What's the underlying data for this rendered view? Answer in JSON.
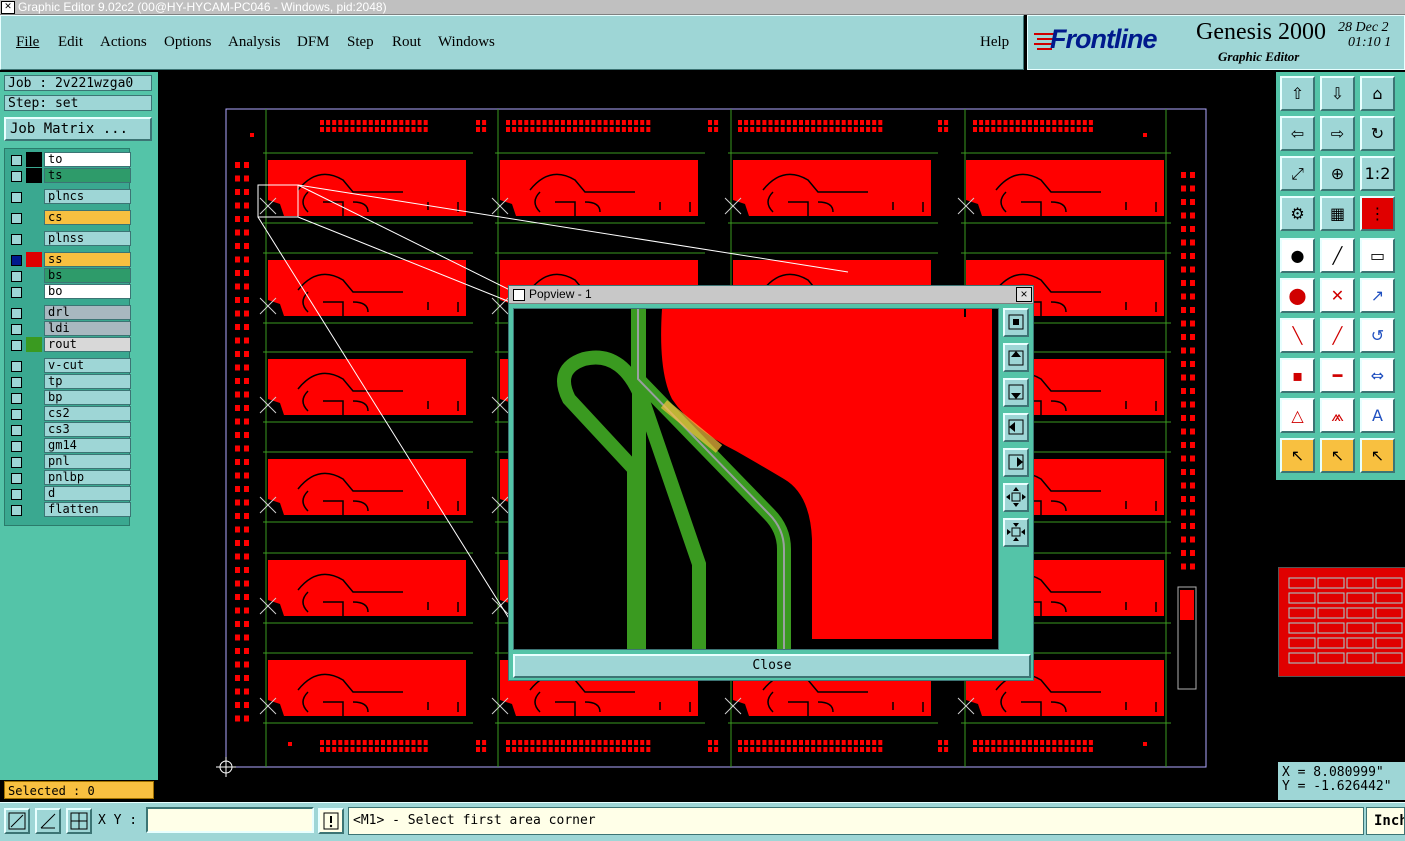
{
  "window": {
    "title": "Graphic Editor 9.02c2 (00@HY-HYCAM-PC046 - Windows, pid:2048)"
  },
  "menu": [
    "File",
    "Edit",
    "Actions",
    "Options",
    "Analysis",
    "DFM",
    "Step",
    "Rout",
    "Windows"
  ],
  "help": "Help",
  "brand": {
    "logo": "Frontline",
    "product": "Genesis 2000",
    "subtitle": "Graphic Editor",
    "date": "28 Dec 2",
    "time": "01:10 1"
  },
  "job": {
    "job_label": "Job : 2v221wzga0",
    "step_label": "Step: set",
    "matrix_button": "Job Matrix ..."
  },
  "layers": [
    {
      "name": "to",
      "color": "#ffffff",
      "sw": "#000000"
    },
    {
      "name": "ts",
      "color": "#2e9b6a",
      "sw": "#000000"
    },
    {
      "name": "plncs",
      "color": "#9ed6d6",
      "sw": "#54c4a8"
    },
    {
      "name": "cs",
      "color": "#f8c040",
      "sw": "#54c4a8"
    },
    {
      "name": "plnss",
      "color": "#9ed6d6",
      "sw": "#54c4a8"
    },
    {
      "name": "ss",
      "color": "#f8c040",
      "sw": "#e00000"
    },
    {
      "name": "bs",
      "color": "#2e9b6a",
      "sw": "#54c4a8"
    },
    {
      "name": "bo",
      "color": "#ffffff",
      "sw": "#54c4a8"
    },
    {
      "name": "drl",
      "color": "#a8b8c0",
      "sw": "#54c4a8"
    },
    {
      "name": "ldi",
      "color": "#a8b8c0",
      "sw": "#54c4a8"
    },
    {
      "name": "rout",
      "color": "#d8d8d8",
      "sw": "#3a9a20"
    },
    {
      "name": "v-cut",
      "color": "#9ed6d6",
      "sw": "#54c4a8"
    },
    {
      "name": "tp",
      "color": "#9ed6d6",
      "sw": "#54c4a8"
    },
    {
      "name": "bp",
      "color": "#9ed6d6",
      "sw": "#54c4a8"
    },
    {
      "name": "cs2",
      "color": "#9ed6d6",
      "sw": "#54c4a8"
    },
    {
      "name": "cs3",
      "color": "#9ed6d6",
      "sw": "#54c4a8"
    },
    {
      "name": "gm14",
      "color": "#9ed6d6",
      "sw": "#54c4a8"
    },
    {
      "name": "pnl",
      "color": "#9ed6d6",
      "sw": "#54c4a8"
    },
    {
      "name": "pnlbp",
      "color": "#9ed6d6",
      "sw": "#54c4a8"
    },
    {
      "name": "d",
      "color": "#9ed6d6",
      "sw": "#54c4a8"
    },
    {
      "name": "flatten",
      "color": "#9ed6d6",
      "sw": "#54c4a8"
    }
  ],
  "selected": "Selected : 0",
  "coords": {
    "x": "X = 8.080999\"",
    "y": "Y = -1.626442\""
  },
  "status": {
    "xy_label": "X Y :",
    "xy_value": "",
    "prompt": "<M1> - Select first area corner",
    "unit": "Inch"
  },
  "popview": {
    "title": "Popview - 1",
    "close": "Close",
    "close_x": "×"
  },
  "colors": {
    "panel": "#54c4a8",
    "widget": "#9ed6d6",
    "board_red": "#ff0000",
    "trace_green": "#3a9a20",
    "selection_yellow": "#f8c040"
  }
}
